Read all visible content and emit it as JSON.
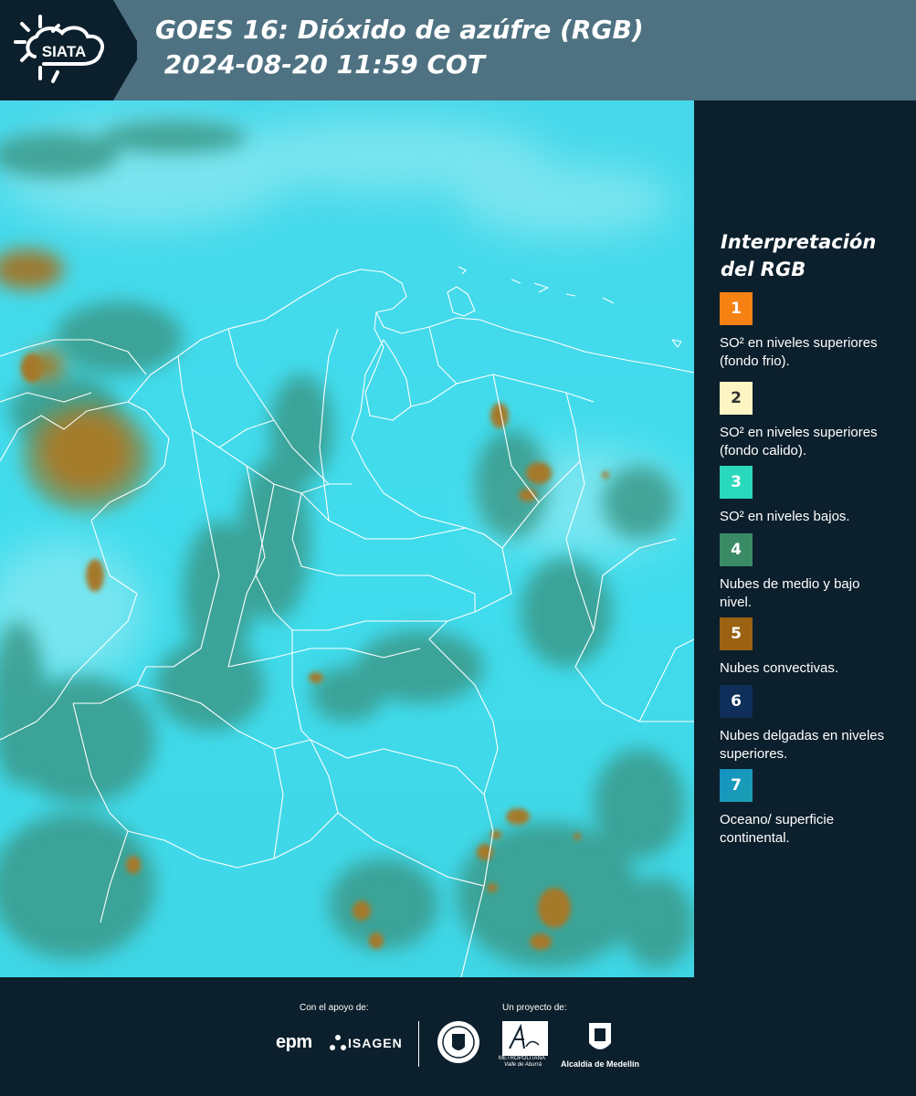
{
  "header": {
    "brand": "SIATA",
    "title_line1": "GOES 16: Dióxido de azúfre (RGB)",
    "title_line2": " 2024-08-20 11:59 COT",
    "background_color": "#4e7282"
  },
  "legend": {
    "title": "Interpretación del RGB",
    "items": [
      {
        "number": "1",
        "label": "SO² en niveles superiores (fondo frio).",
        "color": "#f68213",
        "text_color": "#ffffff"
      },
      {
        "number": "2",
        "label": "SO² en niveles superiores (fondo calido).",
        "color": "#fdf6c3",
        "text_color": "#333333"
      },
      {
        "number": "3",
        "label": "SO² en niveles bajos.",
        "color": "#2ad9bd",
        "text_color": "#ffffff"
      },
      {
        "number": "4",
        "label": "Nubes de medio y bajo nivel.",
        "color": "#3a8a66",
        "text_color": "#ffffff"
      },
      {
        "number": "5",
        "label": "Nubes convectivas.",
        "color": "#9a6212",
        "text_color": "#ffffff"
      },
      {
        "number": "6",
        "label": "Nubes delgadas en niveles superiores.",
        "color": "#0f2e5a",
        "text_color": "#ffffff"
      },
      {
        "number": "7",
        "label": "Oceano/ superficie continental.",
        "color": "#1a8ab5",
        "text_color": "#ffffff"
      }
    ]
  },
  "map": {
    "ocean_land_color": "#43dcec",
    "low_cloud_color": "#3f9f8e",
    "convective_color": "#a77a28",
    "border_color": "#ffffff"
  },
  "footer": {
    "support_label": "Con el apoyo de:",
    "project_label": "Un proyecto de:",
    "sponsor1": "epm",
    "sponsor2": "ISAGEN",
    "partner1_line1": "METROPOLITANA",
    "partner1_line2": "Valle de Aburrá",
    "partner2": "Alcaldía de Medellín"
  }
}
